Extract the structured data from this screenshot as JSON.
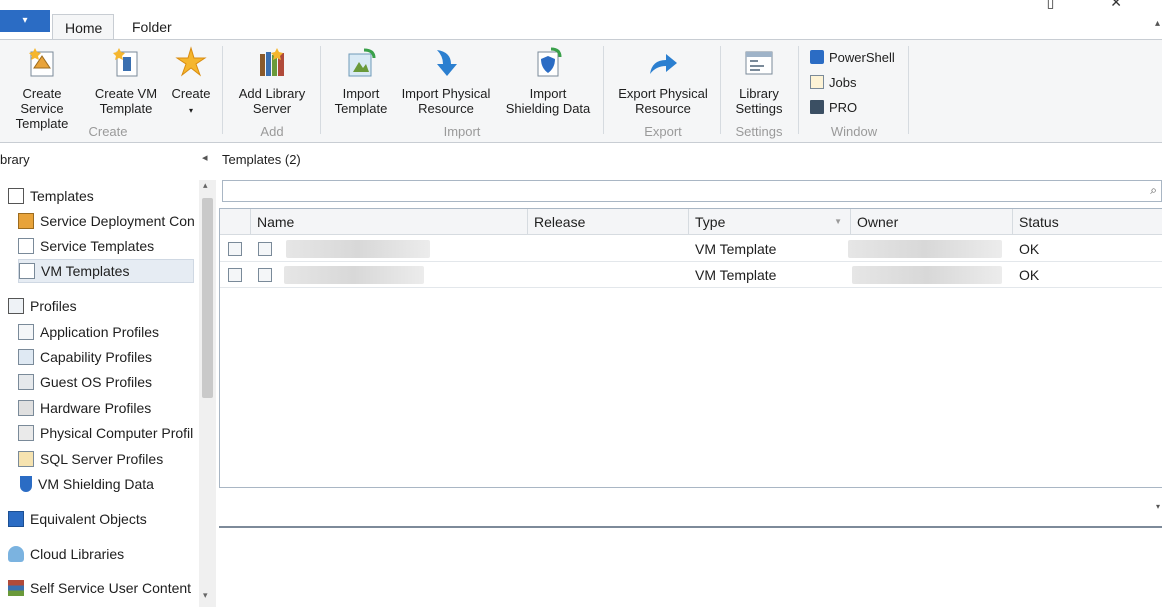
{
  "tabs": {
    "file": "▾",
    "home": "Home",
    "folder": "Folder"
  },
  "window": {
    "controls": "▯ ✕"
  },
  "ribbon": {
    "create_service_template": [
      "Create Service",
      "Template"
    ],
    "create_vm_template": [
      "Create VM",
      "Template"
    ],
    "create": "Create",
    "add_library_server": [
      "Add Library",
      "Server"
    ],
    "import_template": [
      "Import",
      "Template"
    ],
    "import_physical_resource": [
      "Import Physical",
      "Resource"
    ],
    "import_shielding_data": [
      "Import",
      "Shielding Data"
    ],
    "export_physical_resource": [
      "Export Physical",
      "Resource"
    ],
    "library_settings": [
      "Library",
      "Settings"
    ],
    "powershell": "PowerShell",
    "jobs": "Jobs",
    "pro": "PRO",
    "groups": {
      "create": "Create",
      "add": "Add",
      "import": "Import",
      "export": "Export",
      "settings": "Settings",
      "window": "Window"
    }
  },
  "nav": {
    "header": "brary",
    "items": {
      "templates": "Templates",
      "service_deployment": "Service Deployment Con",
      "service_templates": "Service Templates",
      "vm_templates": "VM Templates",
      "profiles": "Profiles",
      "application_profiles": "Application Profiles",
      "capability_profiles": "Capability Profiles",
      "guest_os_profiles": "Guest OS Profiles",
      "hardware_profiles": "Hardware Profiles",
      "physical_computer_profiles": "Physical Computer Profil",
      "sql_server_profiles": "SQL Server Profiles",
      "vm_shielding_data": "VM Shielding Data",
      "equivalent_objects": "Equivalent Objects",
      "cloud_libraries": "Cloud Libraries",
      "self_service_user_content": "Self Service User Content"
    }
  },
  "main": {
    "title": "Templates (2)",
    "search_placeholder": "",
    "columns": {
      "name": "Name",
      "release": "Release",
      "type": "Type",
      "owner": "Owner",
      "status": "Status"
    },
    "rows": [
      {
        "type": "VM Template",
        "status": "OK"
      },
      {
        "type": "VM Template",
        "status": "OK"
      }
    ]
  },
  "colors": {
    "accent": "#2b6cc4",
    "ribbon_bg": "#f5f6f7",
    "selected": "#e6ecf3"
  }
}
